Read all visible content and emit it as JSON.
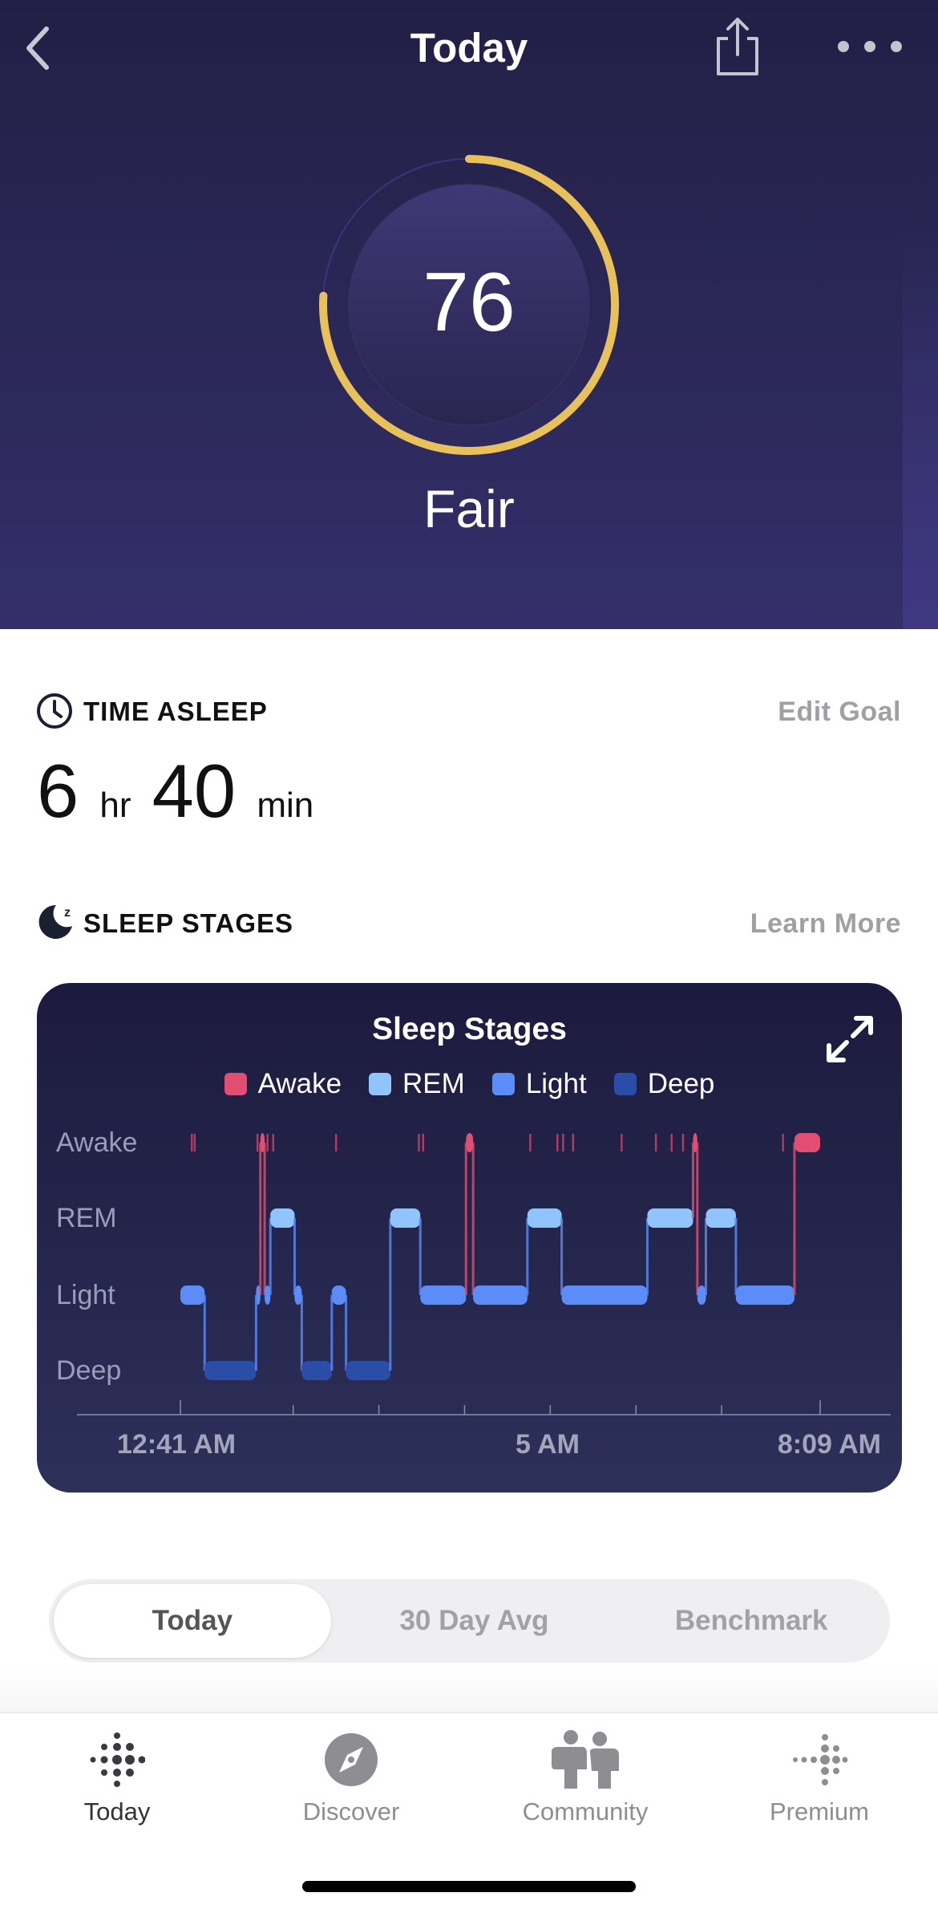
{
  "header": {
    "title": "Today",
    "back_icon": "chevron-left-icon",
    "share_icon": "share-icon",
    "more_icon": "more-dots-icon"
  },
  "score": {
    "value": "76",
    "max": 100,
    "rating": "Fair",
    "ring_color": "#e9c15a"
  },
  "time_asleep": {
    "heading": "TIME ASLEEP",
    "edit_label": "Edit Goal",
    "hours": "6",
    "hr_unit": "hr",
    "minutes": "40",
    "min_unit": "min"
  },
  "sleep_stages": {
    "heading": "SLEEP STAGES",
    "learn_more": "Learn More"
  },
  "chart_data": {
    "type": "line",
    "title": "Sleep Stages",
    "legend": [
      {
        "name": "Awake",
        "color": "#e24d72"
      },
      {
        "name": "REM",
        "color": "#90c4fb"
      },
      {
        "name": "Light",
        "color": "#5b8cf8"
      },
      {
        "name": "Deep",
        "color": "#2a4ea8"
      }
    ],
    "y_categories": [
      "Awake",
      "REM",
      "Light",
      "Deep"
    ],
    "x_tick_labels": [
      "12:41 AM",
      "5 AM",
      "8:09 AM"
    ],
    "x_range": [
      "00:41",
      "08:09"
    ],
    "x_ticks": [
      "00:41",
      "02:00",
      "03:00",
      "04:00",
      "05:00",
      "06:00",
      "07:00",
      "08:09"
    ],
    "segments": [
      {
        "stage": "Light",
        "start": "00:41",
        "end": "00:58"
      },
      {
        "stage": "Deep",
        "start": "00:58",
        "end": "01:34"
      },
      {
        "stage": "Light",
        "start": "01:34",
        "end": "01:37"
      },
      {
        "stage": "Awake",
        "start": "01:37",
        "end": "01:40"
      },
      {
        "stage": "Light",
        "start": "01:40",
        "end": "01:44"
      },
      {
        "stage": "REM",
        "start": "01:44",
        "end": "02:01"
      },
      {
        "stage": "Light",
        "start": "02:01",
        "end": "02:06"
      },
      {
        "stage": "Deep",
        "start": "02:06",
        "end": "02:27"
      },
      {
        "stage": "Light",
        "start": "02:27",
        "end": "02:37"
      },
      {
        "stage": "Deep",
        "start": "02:37",
        "end": "03:08"
      },
      {
        "stage": "REM",
        "start": "03:08",
        "end": "03:29"
      },
      {
        "stage": "Light",
        "start": "03:29",
        "end": "04:01"
      },
      {
        "stage": "Awake",
        "start": "04:01",
        "end": "04:06"
      },
      {
        "stage": "Light",
        "start": "04:06",
        "end": "04:44"
      },
      {
        "stage": "REM",
        "start": "04:44",
        "end": "05:08"
      },
      {
        "stage": "Light",
        "start": "05:08",
        "end": "06:08"
      },
      {
        "stage": "REM",
        "start": "06:08",
        "end": "06:40"
      },
      {
        "stage": "Awake",
        "start": "06:40",
        "end": "06:43"
      },
      {
        "stage": "Light",
        "start": "06:43",
        "end": "06:49"
      },
      {
        "stage": "REM",
        "start": "06:49",
        "end": "07:10"
      },
      {
        "stage": "Light",
        "start": "07:10",
        "end": "07:51"
      },
      {
        "stage": "Awake",
        "start": "07:51",
        "end": "08:09"
      }
    ],
    "brief_awakenings": [
      "00:49",
      "00:51",
      "01:35",
      "01:42",
      "01:46",
      "02:30",
      "03:28",
      "03:31",
      "04:46",
      "05:05",
      "05:09",
      "05:16",
      "05:50",
      "06:14",
      "06:25",
      "06:33",
      "07:43"
    ],
    "expand_icon": "expand-arrows-icon"
  },
  "segmented": {
    "options": [
      "Today",
      "30 Day Avg",
      "Benchmark"
    ],
    "selected": "Today"
  },
  "tabbar": {
    "items": [
      {
        "label": "Today",
        "icon": "fitbit-logo-icon",
        "active": true
      },
      {
        "label": "Discover",
        "icon": "compass-icon"
      },
      {
        "label": "Community",
        "icon": "community-icon"
      },
      {
        "label": "Premium",
        "icon": "premium-icon"
      }
    ]
  }
}
